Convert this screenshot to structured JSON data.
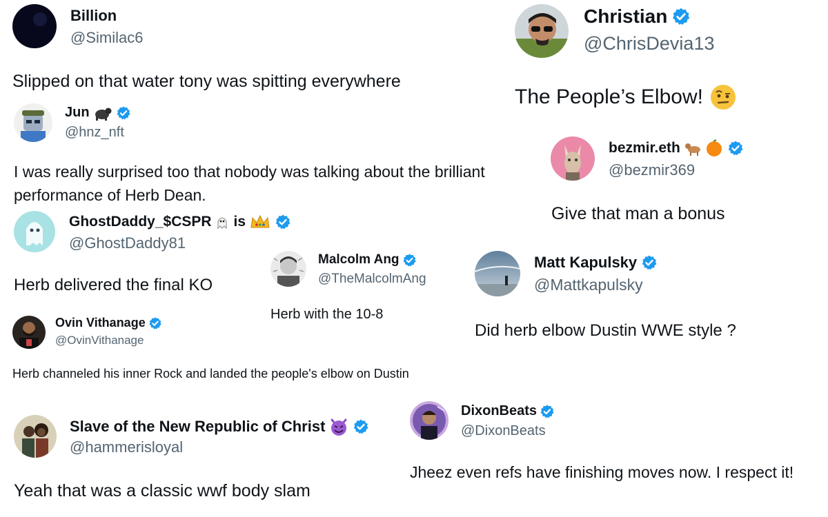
{
  "colors": {
    "verified": "#1d9bf0",
    "handle": "#536471",
    "text": "#0f1419"
  },
  "posts": [
    {
      "name": "Billion",
      "handle": "@Similac6",
      "text": "Slipped on that water tony was spitting everywhere",
      "verified": false,
      "avatar": "dark-avatar"
    },
    {
      "name": "Christian",
      "handle": "@ChrisDevia13",
      "text": "The People’s Elbow!",
      "verified": true,
      "emoji": "raised-eyebrow-face-icon",
      "avatar": "sunglasses-man-avatar"
    },
    {
      "name": "Jun",
      "handle": "@hnz_nft",
      "text_lines": [
        "I was really surprised too that nobody was talking about the brilliant",
        "performance of Herb Dean."
      ],
      "verified": true,
      "emoji": "gorilla-icon",
      "avatar": "nft-robot-avatar"
    },
    {
      "name": "bezmir.eth",
      "handle": "@bezmir369",
      "text": "Give that man a bonus",
      "verified": true,
      "emoji": "dog-and-orange-icons",
      "avatar": "fox-avatar"
    },
    {
      "name": "GhostDaddy_$CSPR",
      "name_suffix": "is",
      "handle": "@GhostDaddy81",
      "text": "Herb delivered the final KO",
      "verified": true,
      "emoji": "ghost-and-crown-icons",
      "avatar": "ghost-avatar"
    },
    {
      "name": "Malcolm Ang",
      "handle": "@TheMalcolmAng",
      "text": "Herb with the 10-8",
      "verified": true,
      "avatar": "sketch-man-avatar"
    },
    {
      "name": "Matt Kapulsky",
      "handle": "@Mattkapulsky",
      "text": "Did herb elbow Dustin WWE style ?",
      "verified": true,
      "avatar": "sky-landscape-avatar"
    },
    {
      "name": "Ovin Vithanage",
      "handle": "@OvinVithanage",
      "text": "Herb channeled his inner Rock and landed the people's elbow on Dustin",
      "verified": true,
      "avatar": "bearded-man-avatar"
    },
    {
      "name": "Slave of the New Republic of Christ",
      "handle": "@hammerisloyal",
      "text": "Yeah that was a classic wwf body slam",
      "verified": true,
      "emoji": "smiling-devil-icon",
      "avatar": "couple-photo-avatar"
    },
    {
      "name": "DixonBeats",
      "handle": "@DixonBeats",
      "text": "Jheez even refs have finishing moves now. I respect it!",
      "verified": true,
      "avatar": "producer-avatar"
    }
  ]
}
